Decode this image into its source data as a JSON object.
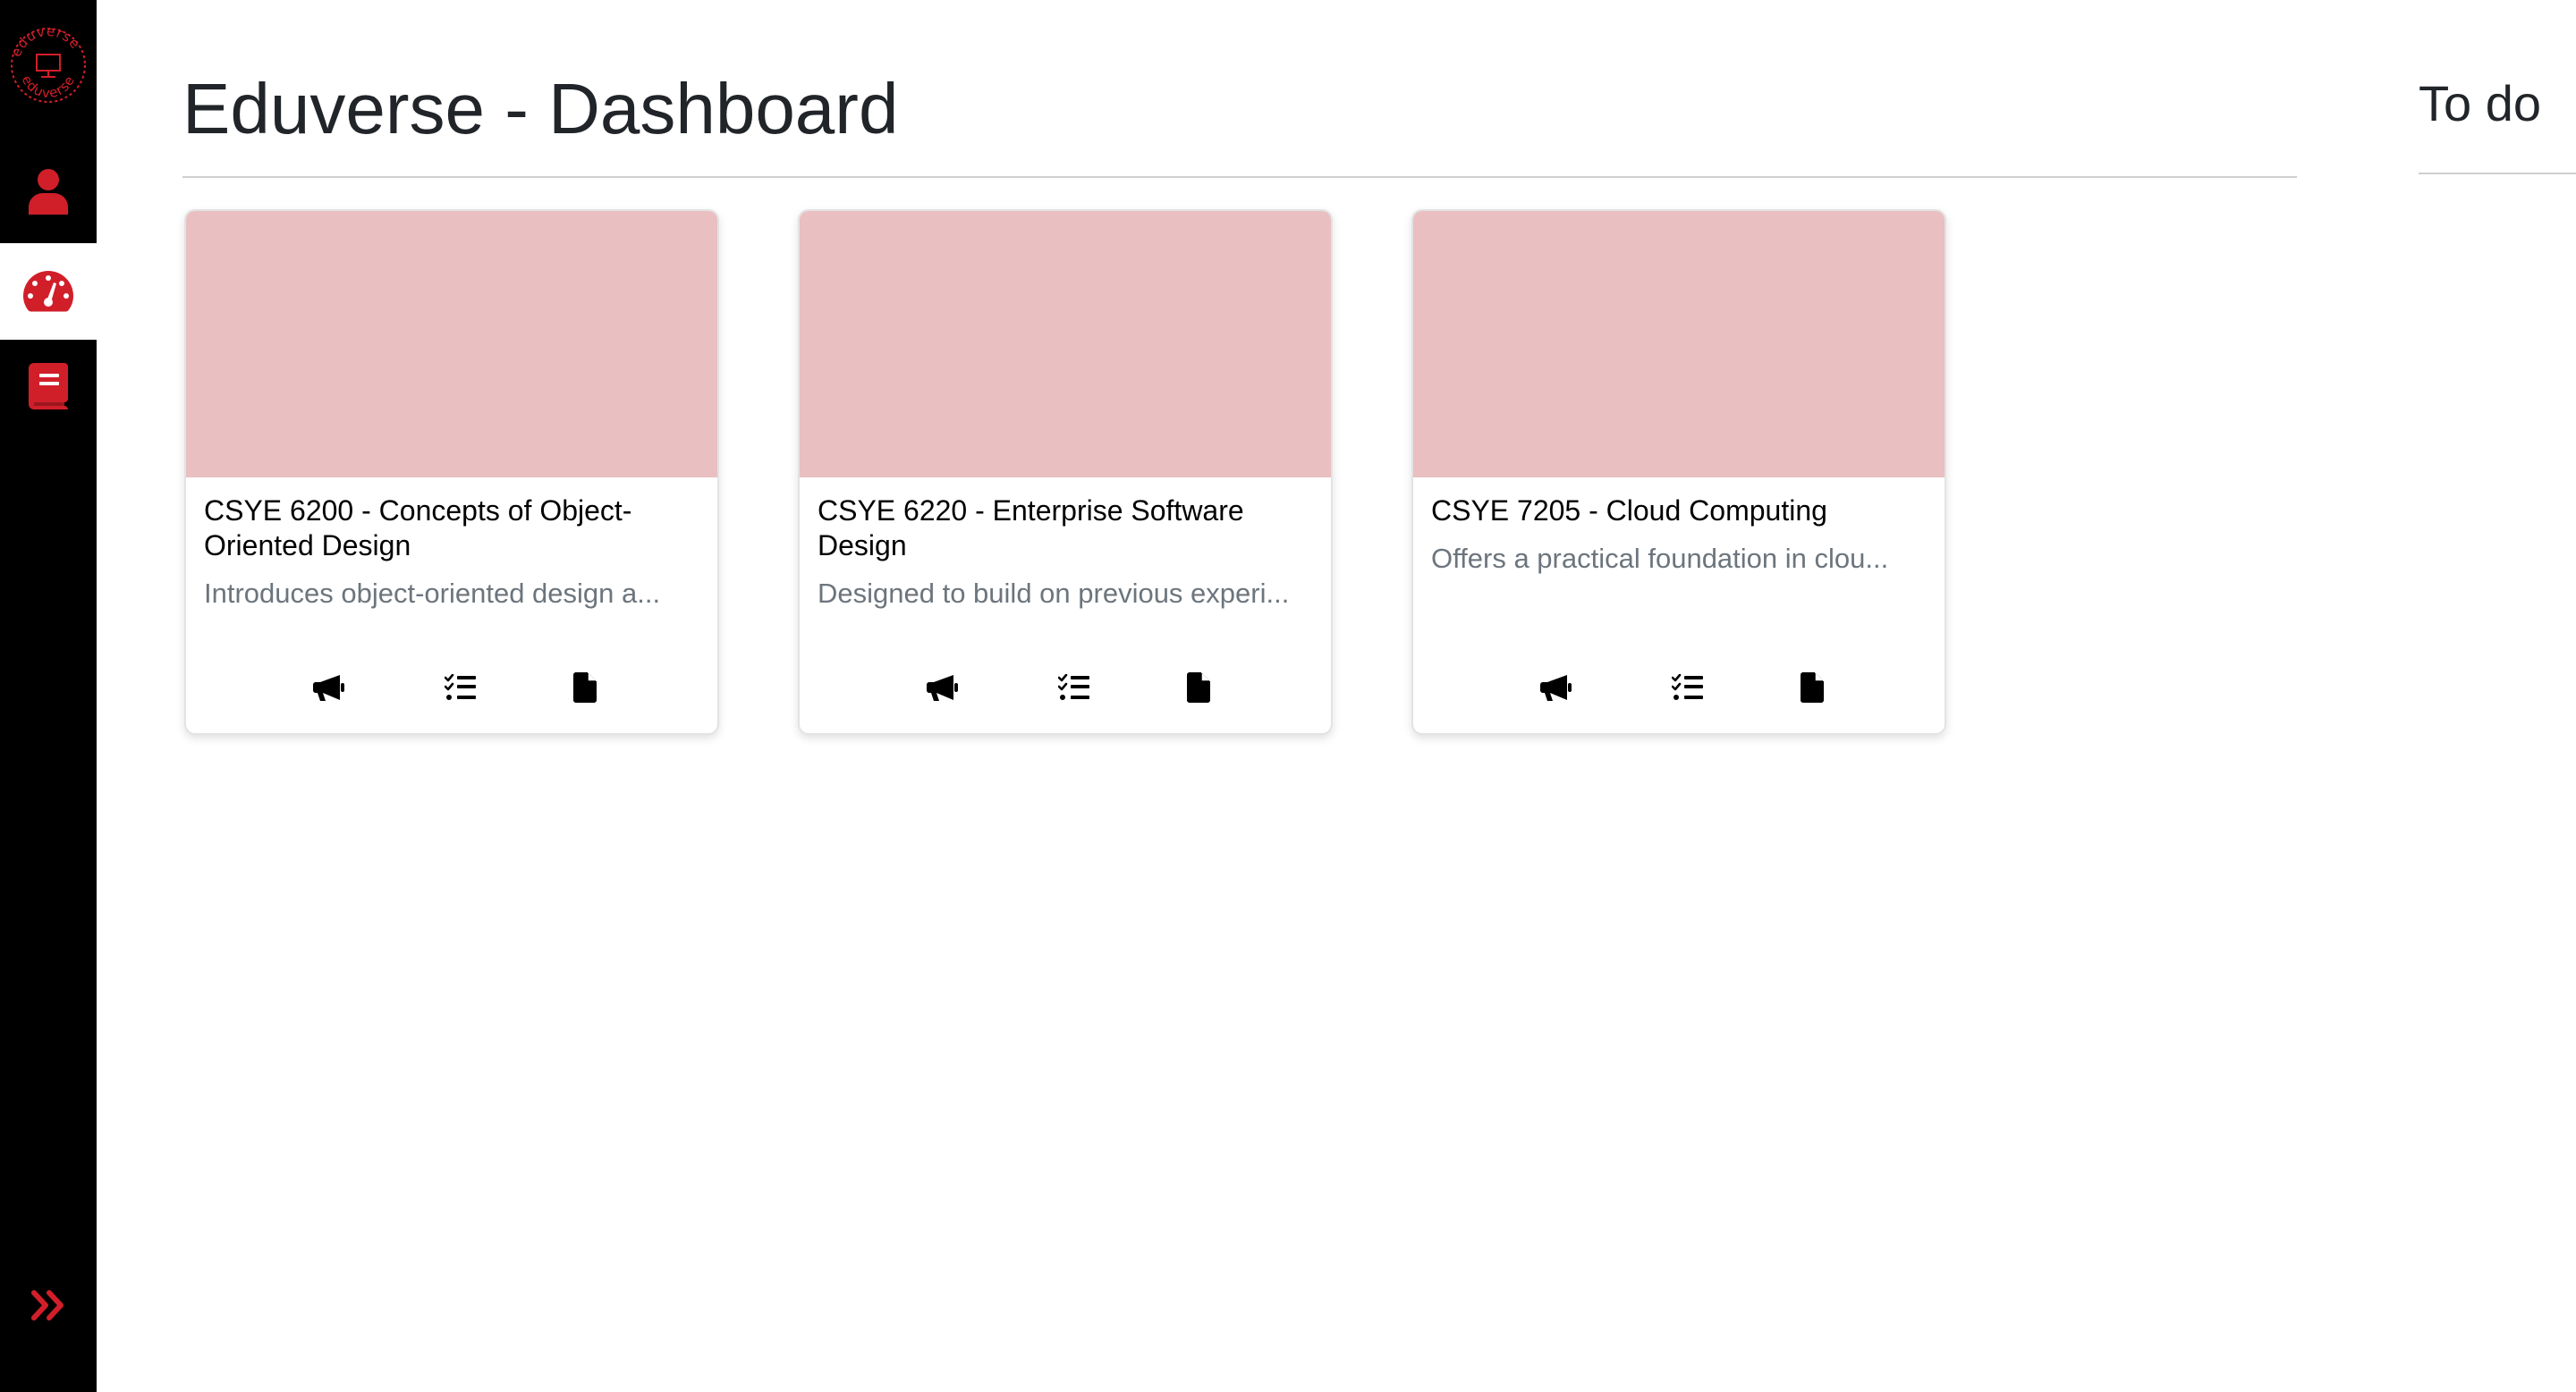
{
  "app": {
    "brand_text": "eduverse",
    "accent_color": "#d11f2a"
  },
  "sidebar": {
    "items": [
      {
        "icon": "user-icon",
        "active": false
      },
      {
        "icon": "gauge-icon",
        "active": true
      },
      {
        "icon": "book-icon",
        "active": false
      }
    ],
    "expand_icon": "chevrons-right-icon"
  },
  "header": {
    "title": "Eduverse - Dashboard"
  },
  "todo": {
    "title": "To do"
  },
  "courses": [
    {
      "title": "CSYE 6200 - Concepts of Object-Oriented Design",
      "description": "Introduces object-oriented design a..."
    },
    {
      "title": "CSYE 6220 - Enterprise Software Design",
      "description": "Designed to build on previous experi..."
    },
    {
      "title": "CSYE 7205 - Cloud Computing",
      "description": "Offers a practical foundation in clou..."
    }
  ],
  "card_actions": [
    "megaphone-icon",
    "checklist-icon",
    "file-icon"
  ],
  "colors": {
    "card_image": "#e9bfc1",
    "sidebar_bg": "#000000",
    "description": "#6c757d"
  }
}
